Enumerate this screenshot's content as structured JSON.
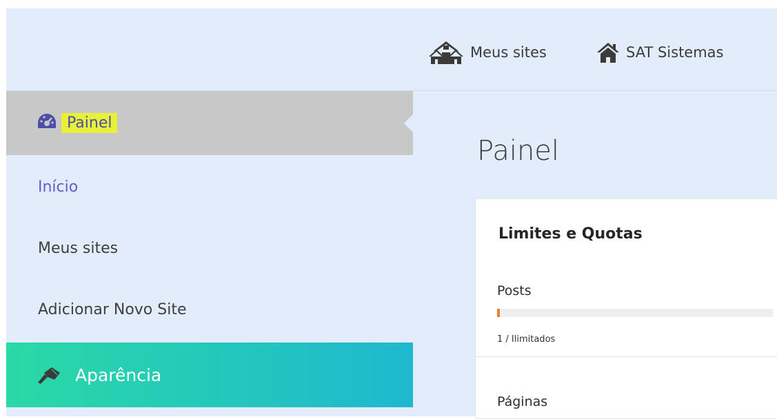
{
  "topbar": {
    "my_sites_label": "Meus sites",
    "my_sites_icon": "houses-icon",
    "site_label": "SAT Sistemas",
    "site_icon": "home-icon"
  },
  "sidebar": {
    "active_item": {
      "label": "Painel",
      "icon": "dashboard-gauge-icon",
      "highlight_color": "#e9f03a"
    },
    "items": [
      {
        "label": "Início",
        "current": true
      },
      {
        "label": "Meus sites"
      },
      {
        "label": "Adicionar Novo Site"
      }
    ],
    "appearance": {
      "label": "Aparência",
      "icon": "brush-icon"
    }
  },
  "main": {
    "title": "Painel",
    "card": {
      "title": "Limites e Quotas",
      "quotas": [
        {
          "label": "Posts",
          "count_text": "1 / Ilimitados",
          "fill_fraction": 0.01
        },
        {
          "label": "Páginas"
        }
      ]
    }
  },
  "colors": {
    "background": "#e3ecfb",
    "active_item_bg": "#c8c8c8",
    "link_accent": "#5a62c8",
    "appearance_gradient_start": "#2ad9a6",
    "appearance_gradient_end": "#1fb8cf",
    "quota_bar": "#e8822b"
  }
}
